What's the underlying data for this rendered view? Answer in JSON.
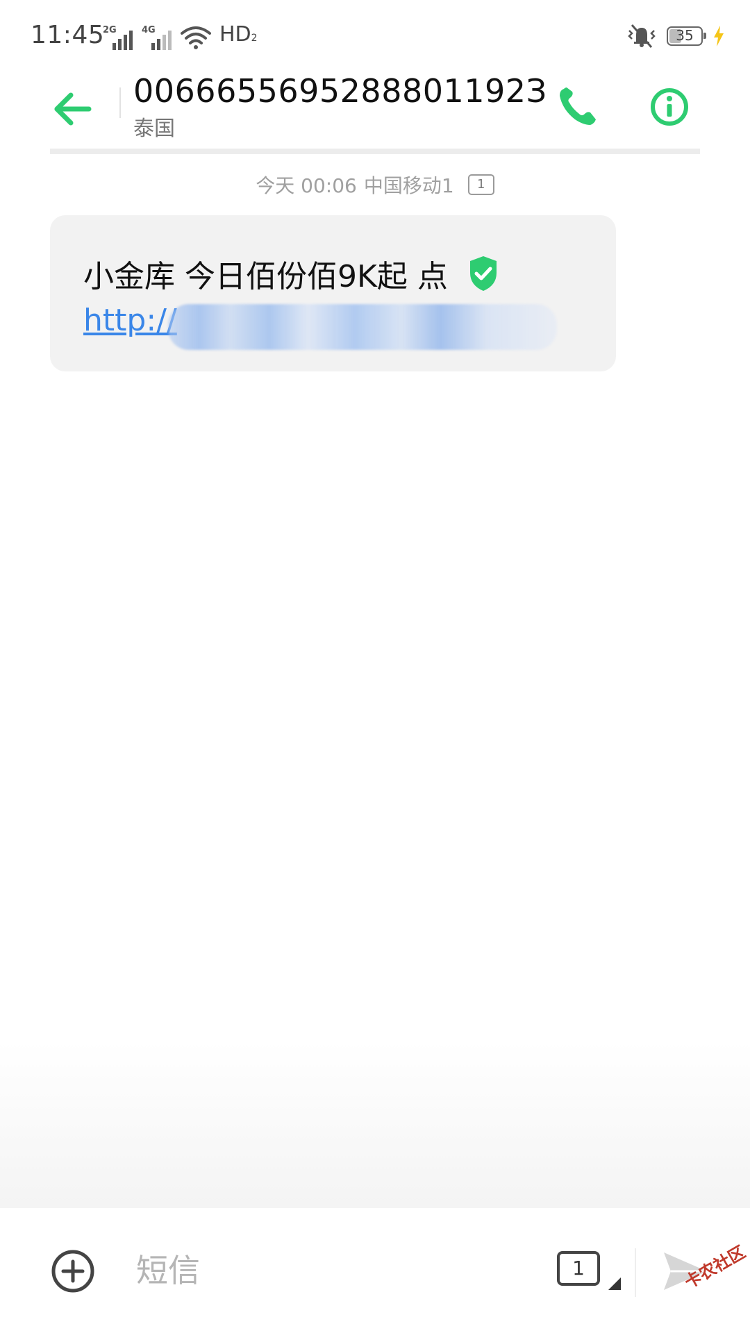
{
  "status_bar": {
    "time": "11:45",
    "network_1": "2G",
    "network_2": "4G",
    "hd_label": "HD",
    "hd_sub": "2",
    "battery_level": "35",
    "icons": [
      "signal-icon",
      "wifi-icon",
      "mute-vibrate-icon",
      "battery-icon",
      "charging-icon"
    ]
  },
  "header": {
    "contact_number": "0066655695288801192З",
    "region": "泰国",
    "back_icon": "arrow-left-icon",
    "call_icon": "phone-icon",
    "info_icon": "info-icon"
  },
  "conversation": {
    "timestamp": "今天 00:06",
    "carrier": "中国移动1",
    "sim_slot": "1",
    "messages": [
      {
        "text": "小金库 今日佰份佰9K起  点",
        "link": "http://",
        "verified_icon": "shield-check-icon"
      }
    ]
  },
  "composer": {
    "placeholder": "短信",
    "sim_slot": "1",
    "add_icon": "plus-circle-icon",
    "send_icon": "send-icon"
  },
  "watermark": "卡农社区",
  "colors": {
    "accent": "#2ecc71",
    "link": "#3a86e8",
    "bubble": "#f2f2f2"
  }
}
